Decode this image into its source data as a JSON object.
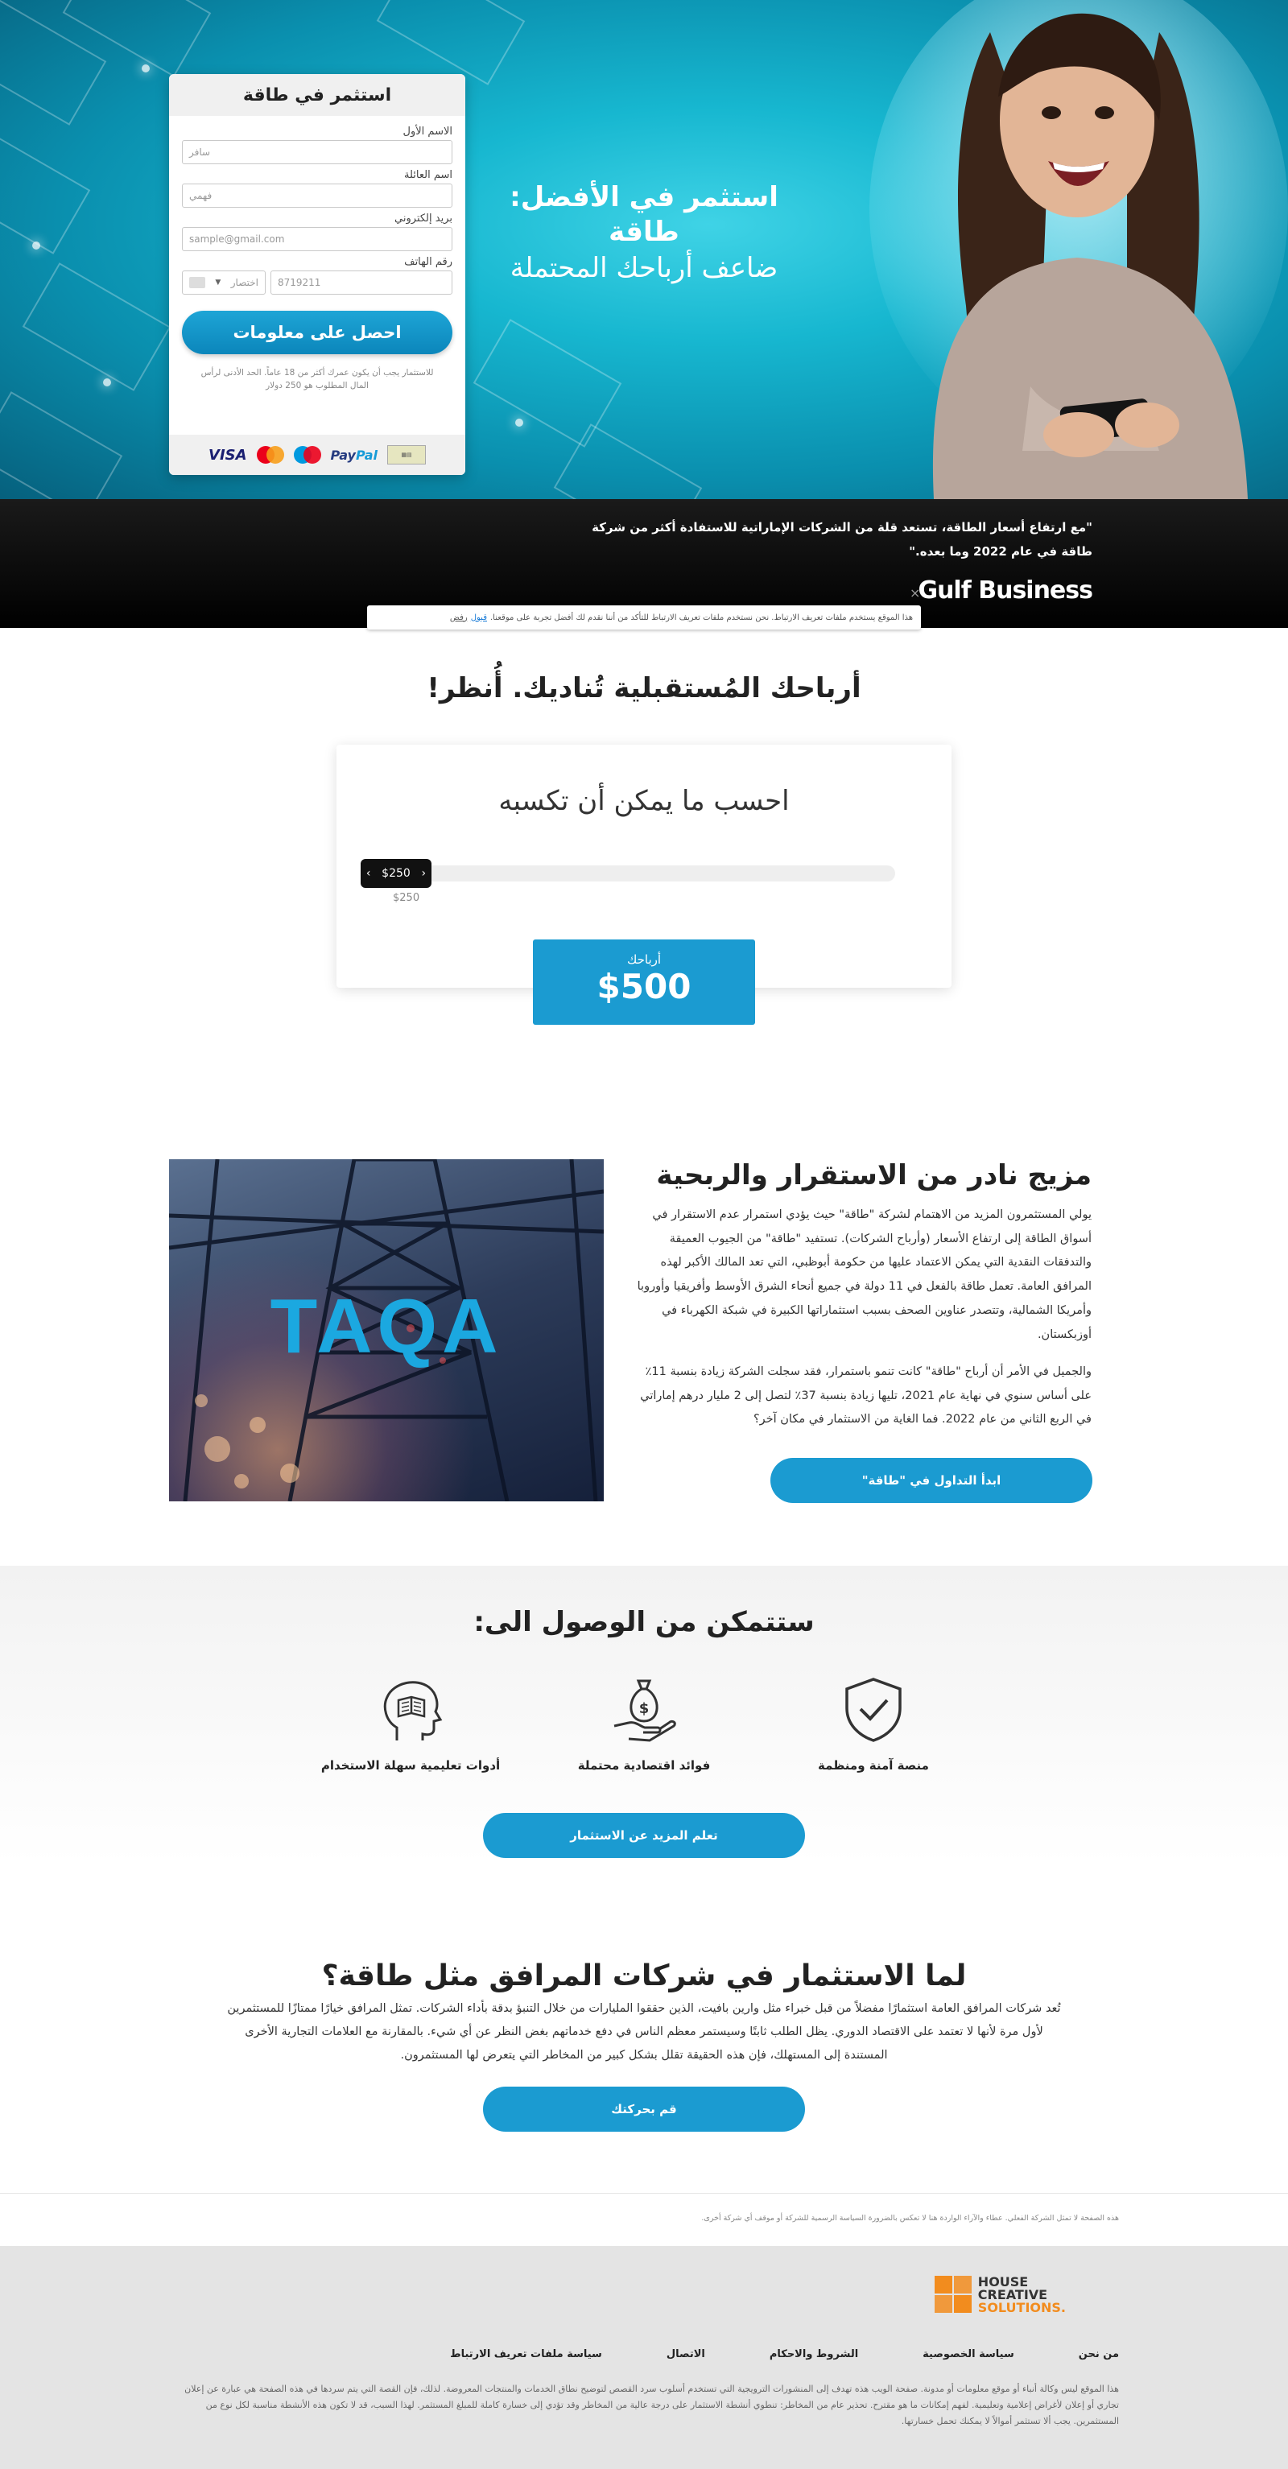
{
  "hero": {
    "headline_line1": "استثمر في الأفضل:",
    "headline_line2": "طاقة",
    "headline_line3": "ضاعف أرباحك المحتملة"
  },
  "form": {
    "title": "استثمر في طاقة",
    "first_name_label": "الاسم الأول",
    "first_name_placeholder": "سافر",
    "last_name_label": "اسم العائلة",
    "last_name_placeholder": "فهمي",
    "email_label": "بريد إلكتروني",
    "email_placeholder": "sample@gmail.com",
    "phone_label": "رقم الهاتف",
    "phone_placeholder": "8719211",
    "country_code_placeholder": "اختصار",
    "submit_label": "احصل على معلومات",
    "disclaimer": "للاستثمار يجب أن يكون عمرك أكثر من 18 عاماً. الحد الأدنى لرأس المال المطلوب هو 250 دولار",
    "payment_visa": "VISA",
    "payment_paypal_a": "Pay",
    "payment_paypal_b": "Pal"
  },
  "quote": {
    "text": "\"مع ارتفاع أسعار الطاقة، تستعد قلة من الشركات الإماراتية للاستفادة أكثر من شركة طاقة في عام 2022 وما بعده.\"",
    "source": "Gulf Business"
  },
  "cookie": {
    "text": "هذا الموقع يستخدم ملفات تعريف الارتباط. نحن نستخدم ملفات تعريف الارتباط للتأكد من أننا نقدم لك أفضل تجربة على موقعنا.",
    "accept": "قبول",
    "reject": "رفض"
  },
  "calculator": {
    "section_title": "أرباحك المُستقبلية تُناديك. أُنظر!",
    "title": "احسب ما يمكن أن تكسبه",
    "slider_value": "$250",
    "slider_amount": 250,
    "slider_below": "$250",
    "profit_label": "أرباحك",
    "profit_value": "$500"
  },
  "mix": {
    "title": "مزيج نادر من الاستقرار والربحية",
    "para1": "يولي المستثمرون المزيد من الاهتمام لشركة \"طاقة\" حيث يؤدي استمرار عدم الاستقرار في أسواق الطاقة إلى ارتفاع الأسعار (وأرباح الشركات). تستفيد \"طاقة\" من الجيوب العميقة والتدفقات النقدية التي يمكن الاعتماد عليها من حكومة أبوظبي، التي تعد المالك الأكبر لهذه المرافق العامة. تعمل طاقة بالفعل في 11 دولة في جميع أنحاء الشرق الأوسط وأفريقيا وأوروبا وأمريكا الشمالية، وتتصدر عناوين الصحف بسبب استثماراتها الكبيرة في شبكة الكهرباء في أوزبكستان.",
    "para2": "والجميل في الأمر أن أرباح \"طاقة\" كانت تنمو باستمرار، فقد سجلت الشركة زيادة بنسبة 11٪ على أساس سنوي في نهاية عام 2021، تليها زيادة بنسبة 37٪ لتصل إلى 2 مليار درهم إماراتي في الربع الثاني من عام 2022. فما الغاية من الاستثمار في مكان آخر؟",
    "button": "ابدأ التداول في \"طاقة\"",
    "image_logo": "TAQA"
  },
  "access": {
    "title": "ستتمكن من الوصول الى:",
    "features": [
      {
        "label": "منصة آمنة ومنظمة",
        "icon": "shield-check-icon"
      },
      {
        "label": "فوائد اقتصادية محتملة",
        "icon": "money-bag-hand-icon"
      },
      {
        "label": "أدوات تعليمية سهلة الاستخدام",
        "icon": "head-book-icon"
      }
    ],
    "button": "تعلم المزيد عن الاستثمار"
  },
  "why": {
    "title": "لما الاستثمار في شركات المرافق مثل طاقة؟",
    "paragraph": "تُعد شركات المرافق العامة استثمارًا مفضلاً من قبل خبراء مثل وارين بافيت، الذين حققوا المليارات من خلال التنبؤ بدقة بأداء الشركات. تمثل المرافق خيارًا ممتازًا للمستثمرين لأول مرة لأنها لا تعتمد على الاقتصاد الدوري. يظل الطلب ثابتًا وسيستمر معظم الناس في دفع خدماتهم بغض النظر عن أي شيء. بالمقارنة مع العلامات التجارية الأخرى المستندة إلى المستهلك، فإن هذه الحقيقة تقلل بشكل كبير من المخاطر التي يتعرض لها المستثمرون.",
    "button": "قم بحركتك"
  },
  "footer": {
    "note": "هذه الصفحة لا تمثل الشركة الفعلي. عطاء والآراء الواردة هنا لا تعكس بالضرورة السياسة الرسمية للشركة أو موقف أي شركة أخرى.",
    "logo_line1": "HOUSE",
    "logo_line2": "CREATIVE",
    "logo_line3": "SOLUTIONS.",
    "links": [
      "من نحن",
      "سياسة الخصوصية",
      "الشروط والاحكام",
      "الاتصال",
      "سياسة ملفات تعريف الارتباط"
    ],
    "disclaimer": "هذا الموقع ليس وكالة أنباء أو موقع معلومات أو مدونة. صفحة الويب هذه تهدف إلى المنشورات الترويجية التي تستخدم أسلوب سرد القصص لتوضيح نطاق الخدمات والمنتجات المعروضة. لذلك، فإن القصة التي يتم سردها في هذه الصفحة هي عبارة عن إعلان تجاري أو إعلان لأغراض إعلامية وتعليمية. لفهم إمكانات ما هو مقترح. تحذير عام من المخاطر: تنطوي أنشطة الاستثمار على درجة عالية من المخاطر وقد تؤدي إلى خسارة كاملة للمبلغ المستثمر. لهذا السبب، قد لا تكون هذه الأنشطة مناسبة لكل نوع من المستثمرين. يجب ألا تستثمر أموالاً لا يمكنك تحمل خسارتها."
  }
}
